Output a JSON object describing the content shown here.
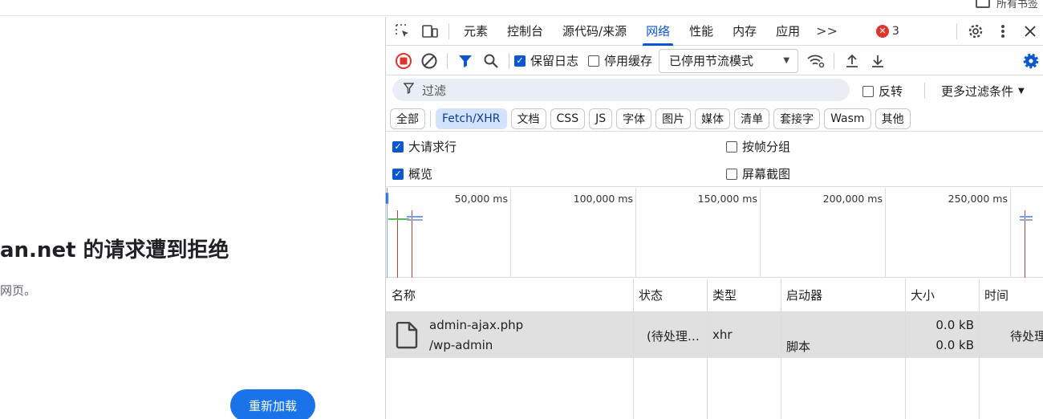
{
  "page": {
    "error_title": "an.net 的请求遭到拒绝",
    "error_subtitle": "网页。",
    "reload_label": "重新加载",
    "bookmark_label": "所有书签"
  },
  "devtools": {
    "tabs": [
      {
        "label": "元素",
        "active": false
      },
      {
        "label": "控制台",
        "active": false
      },
      {
        "label": "源代码/来源",
        "active": false
      },
      {
        "label": "网络",
        "active": true
      },
      {
        "label": "性能",
        "active": false
      },
      {
        "label": "内存",
        "active": false
      },
      {
        "label": "应用",
        "active": false
      }
    ],
    "more_tabs": ">>",
    "error_count": "3",
    "toolbar": {
      "preserve_log": "保留日志",
      "preserve_log_checked": true,
      "disable_cache": "停用缓存",
      "disable_cache_checked": false,
      "throttle": "已停用节流模式"
    },
    "filter": {
      "placeholder": "过滤",
      "invert": "反转",
      "more_filters": "更多过滤条件"
    },
    "types": [
      {
        "label": "全部",
        "active": false
      },
      {
        "label": "Fetch/XHR",
        "active": true
      },
      {
        "label": "文档",
        "active": false
      },
      {
        "label": "CSS",
        "active": false
      },
      {
        "label": "JS",
        "active": false
      },
      {
        "label": "字体",
        "active": false
      },
      {
        "label": "图片",
        "active": false
      },
      {
        "label": "媒体",
        "active": false
      },
      {
        "label": "清单",
        "active": false
      },
      {
        "label": "套接字",
        "active": false
      },
      {
        "label": "Wasm",
        "active": false
      },
      {
        "label": "其他",
        "active": false
      }
    ],
    "options": {
      "big_rows": "大请求行",
      "big_rows_checked": true,
      "overview": "概览",
      "overview_checked": true,
      "group_by_frame": "按帧分组",
      "group_by_frame_checked": false,
      "screenshots": "屏幕截图",
      "screenshots_checked": false
    },
    "timeline": {
      "ticks": [
        "50,000 ms",
        "100,000 ms",
        "150,000 ms",
        "200,000 ms",
        "250,000 ms"
      ]
    },
    "table": {
      "columns": [
        "名称",
        "状态",
        "类型",
        "启动器",
        "大小",
        "时间"
      ],
      "rows": [
        {
          "name": "admin-ajax.php",
          "path": "/wp-admin",
          "status": "(待处理…",
          "type": "xhr",
          "initiator": "脚本",
          "size_top": "0.0 kB",
          "size_bottom": "0.0 kB",
          "time": "待处理"
        }
      ]
    },
    "colors": {
      "accent": "#0b57d0",
      "record": "#dc362e",
      "error": "#dc362e",
      "selected_row": "#e0e0e0"
    }
  }
}
